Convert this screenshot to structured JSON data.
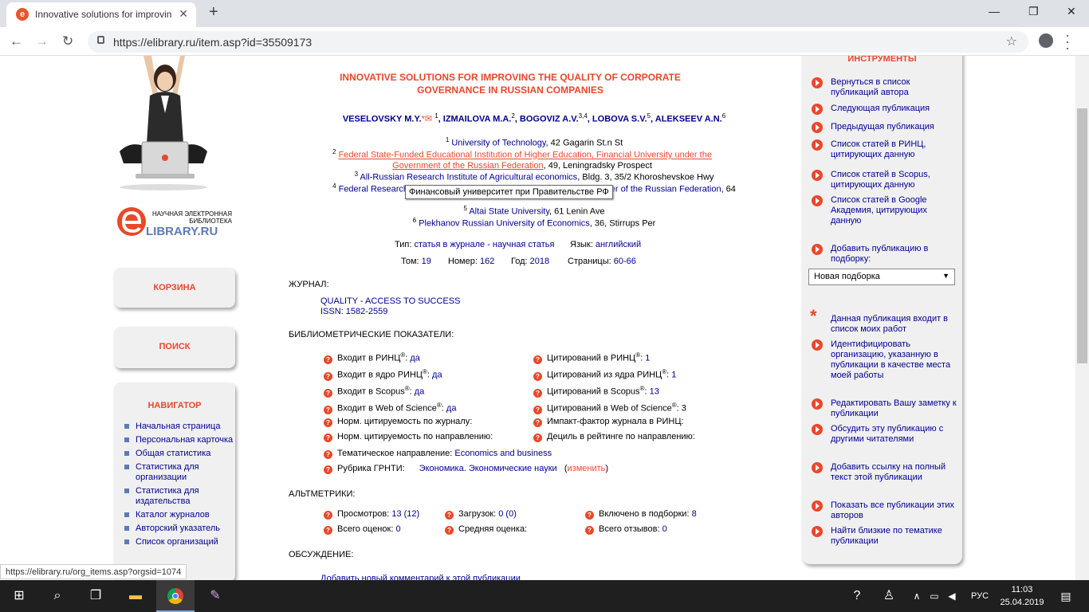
{
  "browser": {
    "tab_title": "Innovative solutions for improvin",
    "tab_close": "✕",
    "new_tab": "+",
    "url": "https://elibrary.ru/item.asp?id=35509173",
    "window": {
      "minimize": "—",
      "maximize": "❐",
      "close": "✕"
    },
    "nav": {
      "back": "←",
      "forward": "→",
      "reload": "↻"
    },
    "status_url": "https://elibrary.ru/org_items.asp?orgsid=1074"
  },
  "logo": {
    "line1": "НАУЧНАЯ ЭЛЕКТРОННАЯ",
    "line2": "БИБЛИОТЕКА",
    "brand": "LIBRARY.RU"
  },
  "left": {
    "cart": "КОРЗИНА",
    "search": "ПОИСК",
    "navigator": "НАВИГАТОР",
    "nav_items": [
      "Начальная страница",
      "Персональная карточка",
      "Общая статистика",
      "Статистика для организации",
      "Статистика для издательства",
      "Каталог журналов",
      "Авторский указатель",
      "Список организаций"
    ]
  },
  "article": {
    "title": "INNOVATIVE SOLUTIONS FOR IMPROVING THE QUALITY OF CORPORATE GOVERNANCE IN RUSSIAN COMPANIES",
    "authors": [
      {
        "name": "VESELOVSKY M.Y.",
        "sup": "1"
      },
      {
        "name": "IZMAILOVA M.A.",
        "sup": "2"
      },
      {
        "name": "BOGOVIZ A.V.",
        "sup": "3,4"
      },
      {
        "name": "LOBOVA S.V.",
        "sup": "5"
      },
      {
        "name": "ALEKSEEV A.N.",
        "sup": "6"
      }
    ],
    "affiliations": [
      {
        "n": "1",
        "org": "University of Technology",
        "addr": ", 42 Gagarin St.n St"
      },
      {
        "n": "2",
        "org": "Federal State-Funded Educational Institution of Higher Education, Financial University under the Government of the Russian Federation",
        "addr": ", 49, Leningradsky Prospect"
      },
      {
        "n": "3",
        "org": "All-Russian Research Institute of Agricultural economics",
        "addr": ", Bldg. 3, 35/2 Khoroshevskoe Hwy"
      },
      {
        "n": "4",
        "org": "Federal Research Institute of System Analysis of the Accounts Chamber of the Russian Federation",
        "addr": ", 64"
      },
      {
        "n": "5",
        "org": "Altai State University",
        "addr": ", 61 Lenin Ave"
      },
      {
        "n": "6",
        "org": "Plekhanov Russian University of Economics",
        "addr": ", 36, Stirrups Per"
      }
    ],
    "tooltip": "Финансовый университет при Правительстве РФ",
    "type_label": "Тип:",
    "type_value": "статья в журнале - научная статья",
    "lang_label": "Язык:",
    "lang_value": "английский",
    "vol_label": "Том:",
    "vol": "19",
    "num_label": "Номер:",
    "num": "162",
    "year_label": "Год:",
    "year": "2018",
    "pages_label": "Страницы:",
    "pages": "60-66",
    "journal_head": "ЖУРНАЛ:",
    "journal_name": "QUALITY - ACCESS TO SUCCESS",
    "issn": "ISSN: 1582-2559",
    "biblio_head": "БИБЛИОМЕТРИЧЕСКИЕ ПОКАЗАТЕЛИ:",
    "biblio_left": [
      {
        "label": "Входит в РИНЦ",
        "reg": "®",
        "value": "да"
      },
      {
        "label": "Входит в ядро РИНЦ",
        "reg": "®",
        "value": "да"
      },
      {
        "label": "Входит в Scopus",
        "reg": "®",
        "value": "да"
      },
      {
        "label": "Входит в Web of Science",
        "reg": "®",
        "value": "да"
      },
      {
        "label": "Норм. цитируемость по журналу:",
        "reg": "",
        "value": ""
      },
      {
        "label": "Норм. цитируемость по направлению:",
        "reg": "",
        "value": ""
      }
    ],
    "biblio_right": [
      {
        "label": "Цитирований в РИНЦ",
        "reg": "®",
        "value": "1"
      },
      {
        "label": "Цитирований из ядра РИНЦ",
        "reg": "®",
        "value": "1"
      },
      {
        "label": "Цитирований в Scopus",
        "reg": "®",
        "value": "13"
      },
      {
        "label": "Цитирований в Web of Science",
        "reg": "®",
        "value": "3"
      },
      {
        "label": "Импакт-фактор журнала в РИНЦ:",
        "reg": "",
        "value": ""
      },
      {
        "label": "Дециль в рейтинге по направлению:",
        "reg": "",
        "value": ""
      }
    ],
    "theme_label": "Тематическое направление:",
    "theme_value": "Economics and business",
    "grnti_label": "Рубрика ГРНТИ:",
    "grnti_value": "Экономика. Экономические науки",
    "grnti_change": "изменить",
    "altm_head": "АЛЬТМЕТРИКИ:",
    "altm": [
      {
        "label": "Просмотров:",
        "value": "13 (12)"
      },
      {
        "label": "Загрузок:",
        "value": "0 (0)"
      },
      {
        "label": "Включено в подборки:",
        "value": "8"
      },
      {
        "label": "Всего оценок:",
        "value": "0"
      },
      {
        "label": "Средняя оценка:",
        "value": ""
      },
      {
        "label": "Всего отзывов:",
        "value": "0"
      }
    ],
    "discussion_head": "ОБСУЖДЕНИЕ:",
    "discussion_link": "Добавить новый комментарий к этой публикации"
  },
  "tools": {
    "head": "ИНСТРУМЕНТЫ",
    "items": [
      "Вернуться в список публикаций автора",
      "Следующая публикация",
      "Предыдущая публикация",
      "Список статей в РИНЦ, цитирующих данную",
      "Список статей в Scopus, цитирующих данную",
      "Список статей в Google Академия, цитирующих данную",
      "Добавить публикацию в подборку:"
    ],
    "select_value": "Новая подборка",
    "items2": [
      "Данная публикация входит в список моих работ",
      "Идентифицировать организацию, указанную в публикации в качестве места моей работы",
      "Редактировать Вашу заметку к публикации",
      "Обсудить эту публикацию с другими читателями",
      "Добавить ссылку на полный текст этой публикации",
      "Показать все публикации этих авторов",
      "Найти близкие по тематике публикации"
    ]
  },
  "taskbar": {
    "lang": "РУС",
    "time": "11:03",
    "date": "25.04.2019"
  }
}
